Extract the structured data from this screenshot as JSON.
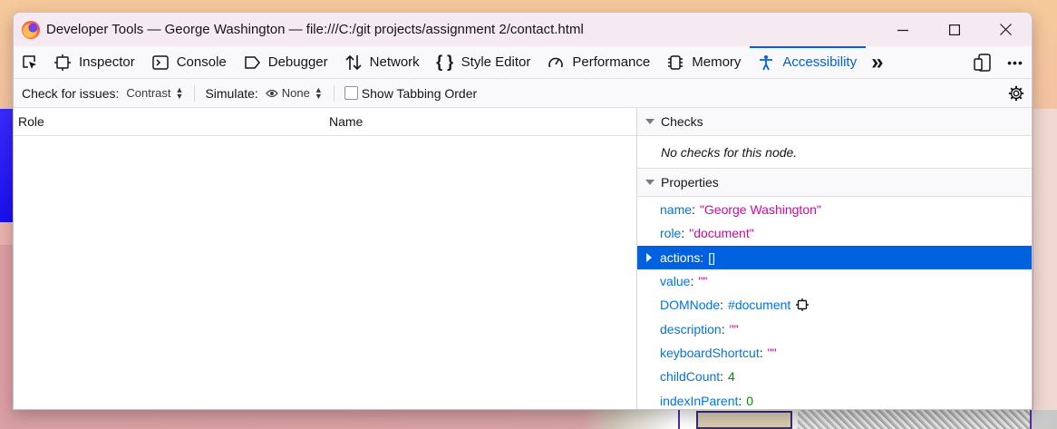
{
  "window": {
    "title": "Developer Tools — George Washington — file:///C:/git projects/assignment 2/contact.html",
    "controls": {
      "minimize": "—",
      "maximize": "☐",
      "close": "✕"
    }
  },
  "toolbar": {
    "tabs": [
      {
        "label": "Inspector",
        "icon": "inspector-icon"
      },
      {
        "label": "Console",
        "icon": "console-icon"
      },
      {
        "label": "Debugger",
        "icon": "debugger-icon"
      },
      {
        "label": "Network",
        "icon": "network-icon"
      },
      {
        "label": "Style Editor",
        "icon": "style-editor-icon"
      },
      {
        "label": "Performance",
        "icon": "performance-icon"
      },
      {
        "label": "Memory",
        "icon": "memory-icon"
      },
      {
        "label": "Accessibility",
        "icon": "accessibility-icon",
        "selected": true
      }
    ],
    "overflow": "»",
    "more": "•••"
  },
  "a11y_bar": {
    "check_label": "Check for issues:",
    "check_value": "Contrast",
    "simulate_label": "Simulate:",
    "simulate_value": "None",
    "tabbing_label": "Show Tabbing Order",
    "tabbing_checked": false
  },
  "tree": {
    "columns": [
      "Role",
      "Name"
    ]
  },
  "sidebar": {
    "checks": {
      "title": "Checks",
      "message": "No checks for this node."
    },
    "properties": {
      "title": "Properties",
      "items": [
        {
          "key": "name",
          "value": "\"George Washington\"",
          "type": "str"
        },
        {
          "key": "role",
          "value": "\"document\"",
          "type": "str"
        },
        {
          "key": "actions",
          "value": "[]",
          "type": "obj",
          "selected": true,
          "expandable": true
        },
        {
          "key": "value",
          "value": "\"\"",
          "type": "str"
        },
        {
          "key": "DOMNode",
          "value": "#document",
          "type": "obj"
        },
        {
          "key": "description",
          "value": "\"\"",
          "type": "str"
        },
        {
          "key": "keyboardShortcut",
          "value": "\"\"",
          "type": "str"
        },
        {
          "key": "childCount",
          "value": "4",
          "type": "num"
        },
        {
          "key": "indexInParent",
          "value": "0",
          "type": "num"
        }
      ]
    }
  },
  "colors": {
    "accent": "#0061e0",
    "string": "#dd00a9",
    "number": "#058b00",
    "key": "#0074e8"
  }
}
